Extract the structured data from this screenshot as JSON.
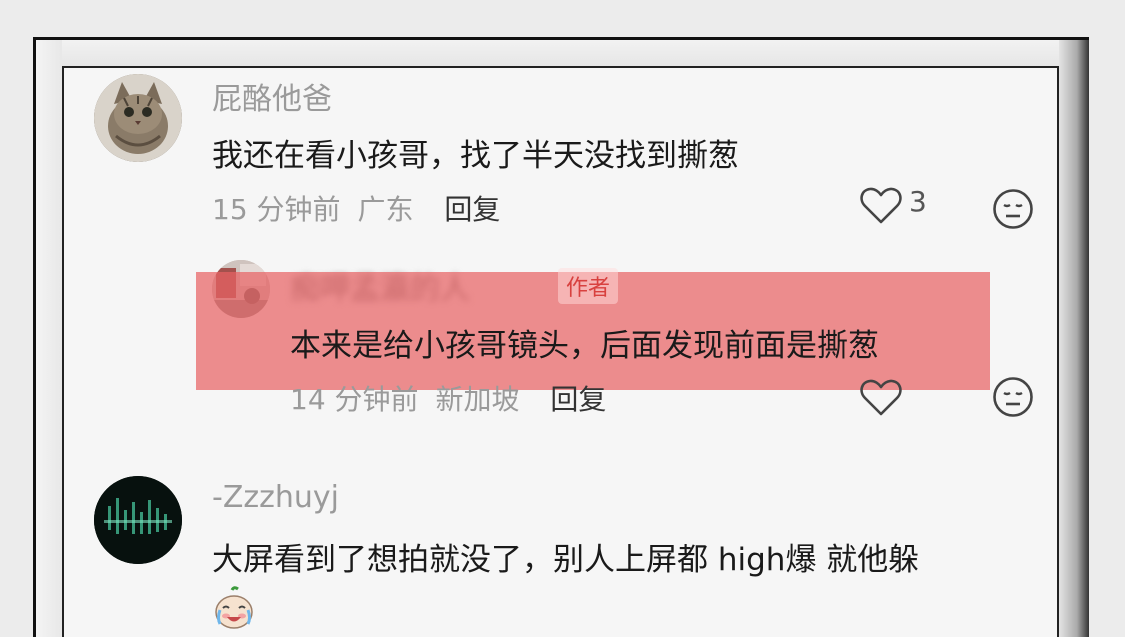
{
  "comments": [
    {
      "username": "屁酪他爸",
      "text": "我还在看小孩哥，找了半天没找到撕葱",
      "time": "15 分钟前",
      "location": "广东",
      "reply_label": "回复",
      "like_count": "3",
      "avatar": "cat-avatar"
    },
    {
      "username": "痴呷孟瀛的人",
      "tag": "作者",
      "text": "本来是给小孩哥镜头，后面发现前面是撕葱",
      "time": "14 分钟前",
      "location": "新加坡",
      "reply_label": "回复",
      "like_count": "",
      "avatar": "author-avatar"
    },
    {
      "username": "-Zzzhuyj",
      "text": "大屏看到了想拍就没了，别人上屏都 high爆 就他躲",
      "avatar": "dark-matrix-avatar",
      "trailing_emoji": "crying-laughing-emoji"
    }
  ],
  "colors": {
    "highlight": "#e86264",
    "author_tag": "#d8413f",
    "meta_text": "#9a9a9a",
    "body_text": "#1a1a1a"
  }
}
